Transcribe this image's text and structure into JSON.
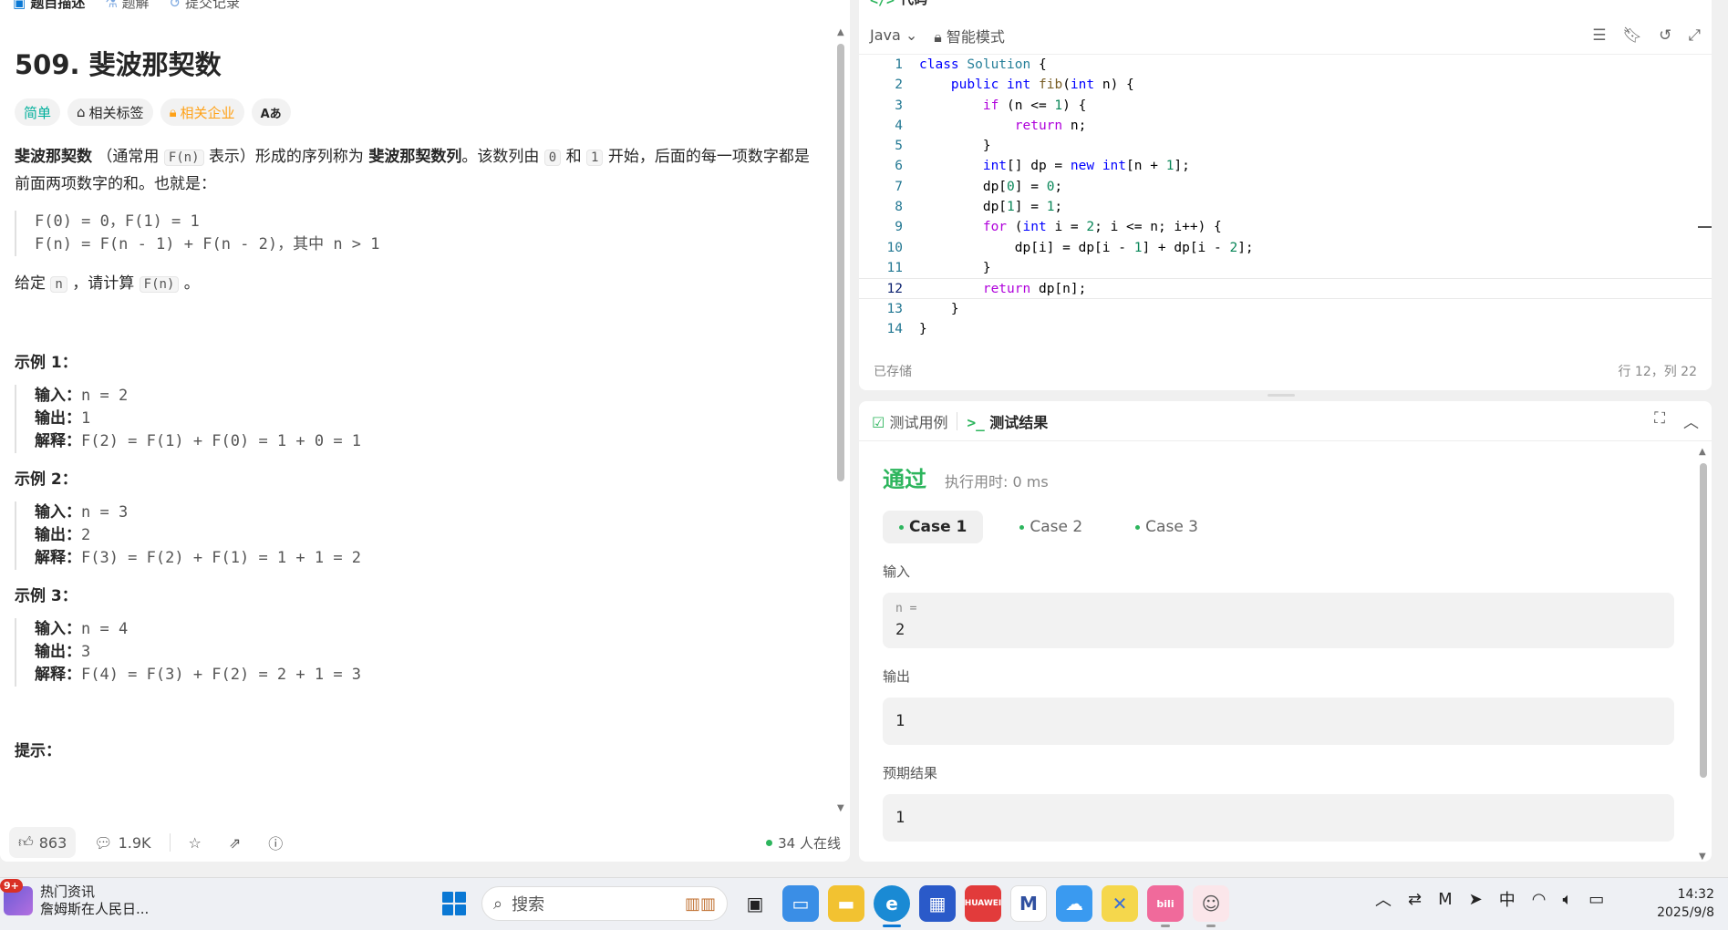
{
  "left": {
    "tabs": [
      "题目描述",
      "题解",
      "提交记录"
    ],
    "title": "509. 斐波那契数",
    "tags": {
      "difficulty": "简单",
      "related_tags": "相关标签",
      "company": "相关企业",
      "font": "Aあ"
    },
    "desc": {
      "p1_a": "斐波那契数",
      "p1_b": "（通常用",
      "p1_fn": "F(n)",
      "p1_c": "表示）形成的序列称为",
      "p1_d": "斐波那契数列",
      "p1_e": "。该数列由",
      "p1_zero": "0",
      "p1_f": "和",
      "p1_one": "1",
      "p1_g": "开始，后面的每一项数字都是前面两项数字的和。也就是：",
      "formula_1": "F(0) = 0，F(1) = 1",
      "formula_2": "F(n) = F(n - 1) + F(n - 2)，其中 n > 1",
      "given_a": "给定",
      "given_n": "n",
      "given_b": "，请计算",
      "given_fn": "F(n)",
      "given_c": "。"
    },
    "examples": [
      {
        "title": "示例 1：",
        "input_label": "输入：",
        "input": "n = 2",
        "output_label": "输出：",
        "output": "1",
        "explain_label": "解释：",
        "explain": "F(2) = F(1) + F(0) = 1 + 0 = 1"
      },
      {
        "title": "示例 2：",
        "input_label": "输入：",
        "input": "n = 3",
        "output_label": "输出：",
        "output": "2",
        "explain_label": "解释：",
        "explain": "F(3) = F(2) + F(1) = 1 + 1 = 2"
      },
      {
        "title": "示例 3：",
        "input_label": "输入：",
        "input": "n = 4",
        "output_label": "输出：",
        "output": "3",
        "explain_label": "解释：",
        "explain": "F(4) = F(3) + F(2) = 2 + 1 = 3"
      }
    ],
    "hint_title": "提示：",
    "footer": {
      "likes": "863",
      "comments": "1.9K",
      "online": "34 人在线"
    }
  },
  "code": {
    "tab": "代码",
    "language": "Java",
    "mode": "智能模式",
    "status_saved": "已存储",
    "status_pos": "行 12，列 22",
    "current_line": 12
  },
  "result": {
    "tab_cases": "测试用例",
    "tab_result": "测试结果",
    "verdict": "通过",
    "runtime": "执行用时: 0 ms",
    "cases": [
      "Case 1",
      "Case 2",
      "Case 3"
    ],
    "input_label": "输入",
    "input_var": "n =",
    "input_value": "2",
    "output_label": "输出",
    "output_value": "1",
    "expected_label": "预期结果",
    "expected_value": "1"
  },
  "taskbar": {
    "news_badge": "9+",
    "news_title": "热门资讯",
    "news_sub": "詹姆斯在人民日...",
    "search_placeholder": "搜索",
    "ime": "中",
    "time": "14:32",
    "date": "2025/9/8"
  },
  "colors": {
    "accent_green": "#2db55d",
    "easy": "#00af9b",
    "company": "#ffa116",
    "windows_blue": "#0a78d4"
  }
}
